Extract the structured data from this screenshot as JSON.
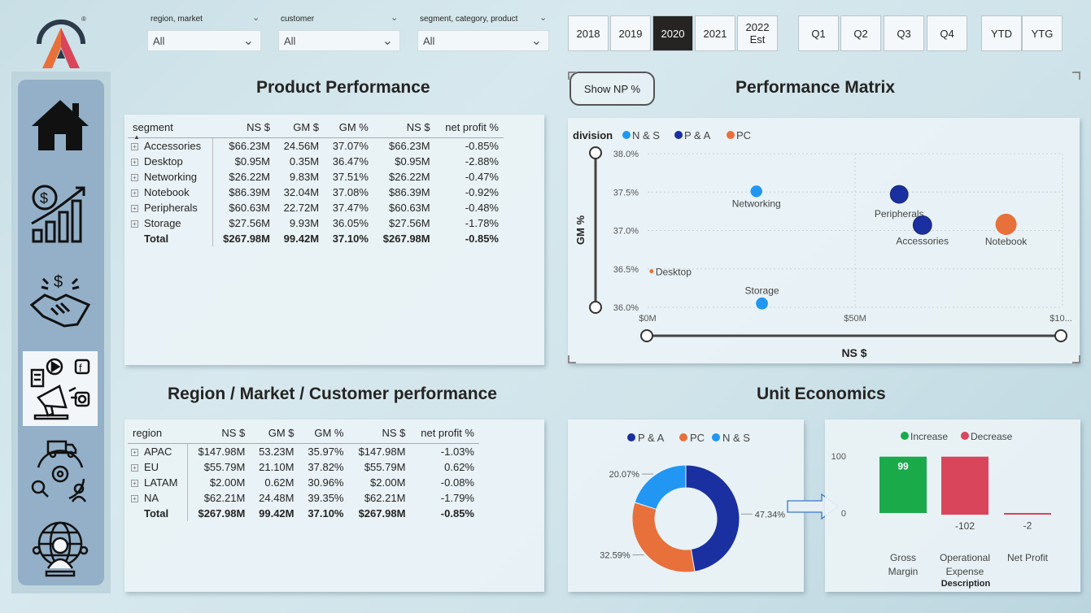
{
  "slicers": [
    {
      "label": "region, market",
      "value": "All"
    },
    {
      "label": "customer",
      "value": "All"
    },
    {
      "label": "segment, category, product",
      "value": "All"
    }
  ],
  "years": [
    {
      "label": "2018",
      "selected": false
    },
    {
      "label": "2019",
      "selected": false
    },
    {
      "label": "2020",
      "selected": true
    },
    {
      "label": "2021",
      "selected": false
    },
    {
      "label": "2022\nEst",
      "selected": false
    }
  ],
  "quarters": [
    "Q1",
    "Q2",
    "Q3",
    "Q4"
  ],
  "periods": [
    "YTD",
    "YTG"
  ],
  "titles": {
    "product": "Product Performance",
    "matrix": "Performance Matrix",
    "region": "Region / Market / Customer performance",
    "unit": "Unit Economics"
  },
  "show_np_label": "Show NP %",
  "product_table": {
    "headers": [
      "segment",
      "NS $",
      "GM $",
      "GM %",
      "NS $",
      "net profit %"
    ],
    "rows": [
      [
        "Accessories",
        "$66.23M",
        "24.56M",
        "37.07%",
        "$66.23M",
        "-0.85%"
      ],
      [
        "Desktop",
        "$0.95M",
        "0.35M",
        "36.47%",
        "$0.95M",
        "-2.88%"
      ],
      [
        "Networking",
        "$26.22M",
        "9.83M",
        "37.51%",
        "$26.22M",
        "-0.47%"
      ],
      [
        "Notebook",
        "$86.39M",
        "32.04M",
        "37.08%",
        "$86.39M",
        "-0.92%"
      ],
      [
        "Peripherals",
        "$60.63M",
        "22.72M",
        "37.47%",
        "$60.63M",
        "-0.48%"
      ],
      [
        "Storage",
        "$27.56M",
        "9.93M",
        "36.05%",
        "$27.56M",
        "-1.78%"
      ]
    ],
    "total": [
      "Total",
      "$267.98M",
      "99.42M",
      "37.10%",
      "$267.98M",
      "-0.85%"
    ]
  },
  "region_table": {
    "headers": [
      "region",
      "NS $",
      "GM $",
      "GM %",
      "NS $",
      "net profit %"
    ],
    "rows": [
      [
        "APAC",
        "$147.98M",
        "53.23M",
        "35.97%",
        "$147.98M",
        "-1.03%"
      ],
      [
        "EU",
        "$55.79M",
        "21.10M",
        "37.82%",
        "$55.79M",
        "0.62%"
      ],
      [
        "LATAM",
        "$2.00M",
        "0.62M",
        "30.96%",
        "$2.00M",
        "-0.08%"
      ],
      [
        "NA",
        "$62.21M",
        "24.48M",
        "39.35%",
        "$62.21M",
        "-1.79%"
      ]
    ],
    "total": [
      "Total",
      "$267.98M",
      "99.42M",
      "37.10%",
      "$267.98M",
      "-0.85%"
    ]
  },
  "colors": {
    "ns": "#2196f3",
    "pa": "#1a2fa0",
    "pc": "#e8703a",
    "increase": "#1aaa4a",
    "decrease": "#d9455a",
    "accent_dark": "#252423"
  },
  "chart_data": [
    {
      "type": "scatter",
      "title": "Performance Matrix",
      "xlabel": "NS $",
      "ylabel": "GM %",
      "legend_title": "division",
      "legend": [
        "N & S",
        "P & A",
        "PC"
      ],
      "legend_placement": "top-left",
      "x_ticks": [
        "$0M",
        "$50M",
        "$10..."
      ],
      "y_ticks": [
        "38.0%",
        "37.5%",
        "37.0%",
        "36.5%",
        "36.0%"
      ],
      "xlim": [
        0,
        100
      ],
      "ylim": [
        36.0,
        38.0
      ],
      "grid": true,
      "points": [
        {
          "label": "Networking",
          "division": "N & S",
          "x": 26.22,
          "y": 37.51,
          "size": 26.22
        },
        {
          "label": "Peripherals",
          "division": "P & A",
          "x": 60.63,
          "y": 37.47,
          "size": 60.63
        },
        {
          "label": "Accessories",
          "division": "P & A",
          "x": 66.23,
          "y": 37.07,
          "size": 66.23
        },
        {
          "label": "Notebook",
          "division": "PC",
          "x": 86.39,
          "y": 37.08,
          "size": 86.39
        },
        {
          "label": "Desktop",
          "division": "PC",
          "x": 0.95,
          "y": 36.47,
          "size": 0.95
        },
        {
          "label": "Storage",
          "division": "N & S",
          "x": 27.56,
          "y": 36.05,
          "size": 27.56
        }
      ]
    },
    {
      "type": "pie",
      "donut": true,
      "legend": [
        "P & A",
        "PC",
        "N & S"
      ],
      "legend_placement": "top",
      "slices": [
        {
          "name": "P & A",
          "value": 47.34,
          "label": "47.34%"
        },
        {
          "name": "PC",
          "value": 32.59,
          "label": "32.59%"
        },
        {
          "name": "N & S",
          "value": 20.07,
          "label": "20.07%"
        }
      ]
    },
    {
      "type": "bar",
      "subtype": "waterfall",
      "legend": [
        "Increase",
        "Decrease"
      ],
      "legend_placement": "top",
      "xlabel": "Description",
      "categories": [
        "Gross Margin",
        "Operational Expense",
        "Net Profit"
      ],
      "values": [
        99,
        -102,
        -2
      ],
      "data_labels": [
        "99",
        "-102",
        "-2"
      ],
      "y_ticks": [
        "100",
        "0"
      ],
      "ylim": [
        -3,
        100
      ]
    }
  ]
}
